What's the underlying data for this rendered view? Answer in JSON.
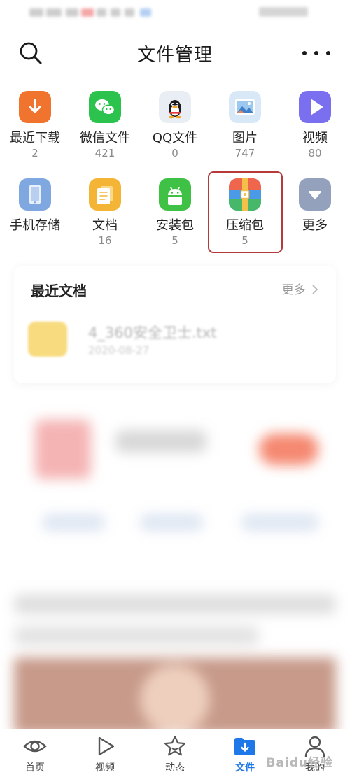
{
  "header": {
    "title": "文件管理"
  },
  "categories": [
    {
      "label": "最近下载",
      "count": "2",
      "icon": "download-icon",
      "color": "#f0742e"
    },
    {
      "label": "微信文件",
      "count": "421",
      "icon": "wechat-icon",
      "color": "#2cc24e"
    },
    {
      "label": "QQ文件",
      "count": "0",
      "icon": "qq-penguin-icon",
      "color": "#e9eef5"
    },
    {
      "label": "图片",
      "count": "747",
      "icon": "picture-icon",
      "color": "#d9e8f7"
    },
    {
      "label": "视频",
      "count": "80",
      "icon": "play-icon",
      "color": "#7a70ef"
    },
    {
      "label": "手机存储",
      "count": "",
      "icon": "phone-icon",
      "color": "#7fa8e0"
    },
    {
      "label": "文档",
      "count": "16",
      "icon": "document-icon",
      "color": "#f4b536"
    },
    {
      "label": "安装包",
      "count": "5",
      "icon": "android-icon",
      "color": "#3ec144"
    },
    {
      "label": "压缩包",
      "count": "5",
      "icon": "archive-icon",
      "color": "#4b9ae8"
    },
    {
      "label": "更多",
      "count": "",
      "icon": "chevron-down-icon",
      "color": "#93a1bc"
    }
  ],
  "recent": {
    "title": "最近文档",
    "more_label": "更多",
    "file": {
      "name": "4_360安全卫士.txt",
      "date": "2020-08-27"
    }
  },
  "tabs": [
    {
      "label": "首页",
      "icon": "eye-icon",
      "active": false
    },
    {
      "label": "视频",
      "icon": "play-icon",
      "active": false
    },
    {
      "label": "动态",
      "icon": "star-icon",
      "active": false
    },
    {
      "label": "文件",
      "icon": "folder-download-icon",
      "active": true
    },
    {
      "label": "我的",
      "icon": "user-icon",
      "active": false
    }
  ],
  "watermark": "Baidu经验",
  "colors": {
    "accent": "#1e78e8",
    "highlight_border": "#b53a3a"
  }
}
